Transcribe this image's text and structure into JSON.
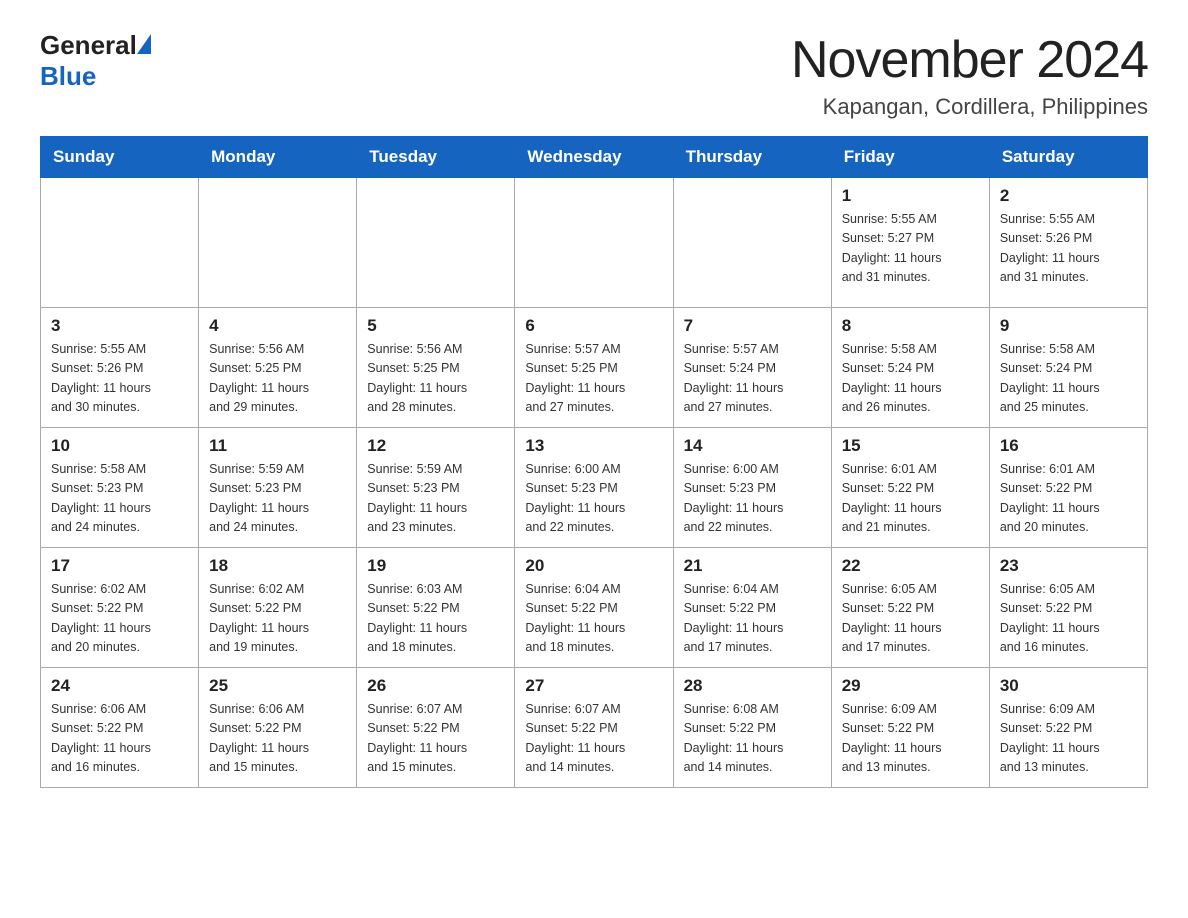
{
  "logo": {
    "general": "General",
    "blue": "Blue"
  },
  "title": "November 2024",
  "subtitle": "Kapangan, Cordillera, Philippines",
  "days_of_week": [
    "Sunday",
    "Monday",
    "Tuesday",
    "Wednesday",
    "Thursday",
    "Friday",
    "Saturday"
  ],
  "weeks": [
    [
      {
        "day": "",
        "info": ""
      },
      {
        "day": "",
        "info": ""
      },
      {
        "day": "",
        "info": ""
      },
      {
        "day": "",
        "info": ""
      },
      {
        "day": "",
        "info": ""
      },
      {
        "day": "1",
        "info": "Sunrise: 5:55 AM\nSunset: 5:27 PM\nDaylight: 11 hours\nand 31 minutes."
      },
      {
        "day": "2",
        "info": "Sunrise: 5:55 AM\nSunset: 5:26 PM\nDaylight: 11 hours\nand 31 minutes."
      }
    ],
    [
      {
        "day": "3",
        "info": "Sunrise: 5:55 AM\nSunset: 5:26 PM\nDaylight: 11 hours\nand 30 minutes."
      },
      {
        "day": "4",
        "info": "Sunrise: 5:56 AM\nSunset: 5:25 PM\nDaylight: 11 hours\nand 29 minutes."
      },
      {
        "day": "5",
        "info": "Sunrise: 5:56 AM\nSunset: 5:25 PM\nDaylight: 11 hours\nand 28 minutes."
      },
      {
        "day": "6",
        "info": "Sunrise: 5:57 AM\nSunset: 5:25 PM\nDaylight: 11 hours\nand 27 minutes."
      },
      {
        "day": "7",
        "info": "Sunrise: 5:57 AM\nSunset: 5:24 PM\nDaylight: 11 hours\nand 27 minutes."
      },
      {
        "day": "8",
        "info": "Sunrise: 5:58 AM\nSunset: 5:24 PM\nDaylight: 11 hours\nand 26 minutes."
      },
      {
        "day": "9",
        "info": "Sunrise: 5:58 AM\nSunset: 5:24 PM\nDaylight: 11 hours\nand 25 minutes."
      }
    ],
    [
      {
        "day": "10",
        "info": "Sunrise: 5:58 AM\nSunset: 5:23 PM\nDaylight: 11 hours\nand 24 minutes."
      },
      {
        "day": "11",
        "info": "Sunrise: 5:59 AM\nSunset: 5:23 PM\nDaylight: 11 hours\nand 24 minutes."
      },
      {
        "day": "12",
        "info": "Sunrise: 5:59 AM\nSunset: 5:23 PM\nDaylight: 11 hours\nand 23 minutes."
      },
      {
        "day": "13",
        "info": "Sunrise: 6:00 AM\nSunset: 5:23 PM\nDaylight: 11 hours\nand 22 minutes."
      },
      {
        "day": "14",
        "info": "Sunrise: 6:00 AM\nSunset: 5:23 PM\nDaylight: 11 hours\nand 22 minutes."
      },
      {
        "day": "15",
        "info": "Sunrise: 6:01 AM\nSunset: 5:22 PM\nDaylight: 11 hours\nand 21 minutes."
      },
      {
        "day": "16",
        "info": "Sunrise: 6:01 AM\nSunset: 5:22 PM\nDaylight: 11 hours\nand 20 minutes."
      }
    ],
    [
      {
        "day": "17",
        "info": "Sunrise: 6:02 AM\nSunset: 5:22 PM\nDaylight: 11 hours\nand 20 minutes."
      },
      {
        "day": "18",
        "info": "Sunrise: 6:02 AM\nSunset: 5:22 PM\nDaylight: 11 hours\nand 19 minutes."
      },
      {
        "day": "19",
        "info": "Sunrise: 6:03 AM\nSunset: 5:22 PM\nDaylight: 11 hours\nand 18 minutes."
      },
      {
        "day": "20",
        "info": "Sunrise: 6:04 AM\nSunset: 5:22 PM\nDaylight: 11 hours\nand 18 minutes."
      },
      {
        "day": "21",
        "info": "Sunrise: 6:04 AM\nSunset: 5:22 PM\nDaylight: 11 hours\nand 17 minutes."
      },
      {
        "day": "22",
        "info": "Sunrise: 6:05 AM\nSunset: 5:22 PM\nDaylight: 11 hours\nand 17 minutes."
      },
      {
        "day": "23",
        "info": "Sunrise: 6:05 AM\nSunset: 5:22 PM\nDaylight: 11 hours\nand 16 minutes."
      }
    ],
    [
      {
        "day": "24",
        "info": "Sunrise: 6:06 AM\nSunset: 5:22 PM\nDaylight: 11 hours\nand 16 minutes."
      },
      {
        "day": "25",
        "info": "Sunrise: 6:06 AM\nSunset: 5:22 PM\nDaylight: 11 hours\nand 15 minutes."
      },
      {
        "day": "26",
        "info": "Sunrise: 6:07 AM\nSunset: 5:22 PM\nDaylight: 11 hours\nand 15 minutes."
      },
      {
        "day": "27",
        "info": "Sunrise: 6:07 AM\nSunset: 5:22 PM\nDaylight: 11 hours\nand 14 minutes."
      },
      {
        "day": "28",
        "info": "Sunrise: 6:08 AM\nSunset: 5:22 PM\nDaylight: 11 hours\nand 14 minutes."
      },
      {
        "day": "29",
        "info": "Sunrise: 6:09 AM\nSunset: 5:22 PM\nDaylight: 11 hours\nand 13 minutes."
      },
      {
        "day": "30",
        "info": "Sunrise: 6:09 AM\nSunset: 5:22 PM\nDaylight: 11 hours\nand 13 minutes."
      }
    ]
  ]
}
